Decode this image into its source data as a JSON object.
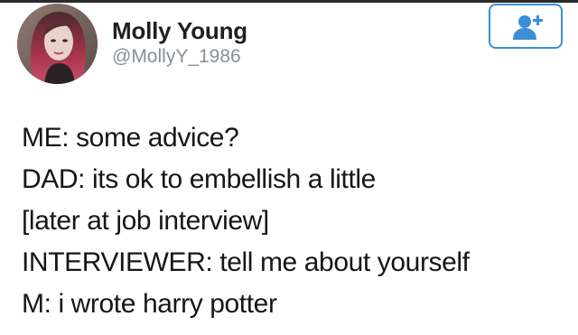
{
  "tweet": {
    "author": {
      "name": "Molly Young",
      "handle": "@MollyY_1986"
    },
    "lines": [
      "ME: some advice?",
      "DAD: its ok to embellish a little",
      "[later at job interview]",
      "INTERVIEWER: tell me about yourself",
      "M: i wrote harry potter"
    ]
  },
  "follow_button": {
    "icon": "add-user-icon",
    "color": "#3b8fd6"
  },
  "colors": {
    "handle": "#8a8f95",
    "text": "#161616",
    "accent": "#3b8fd6"
  }
}
